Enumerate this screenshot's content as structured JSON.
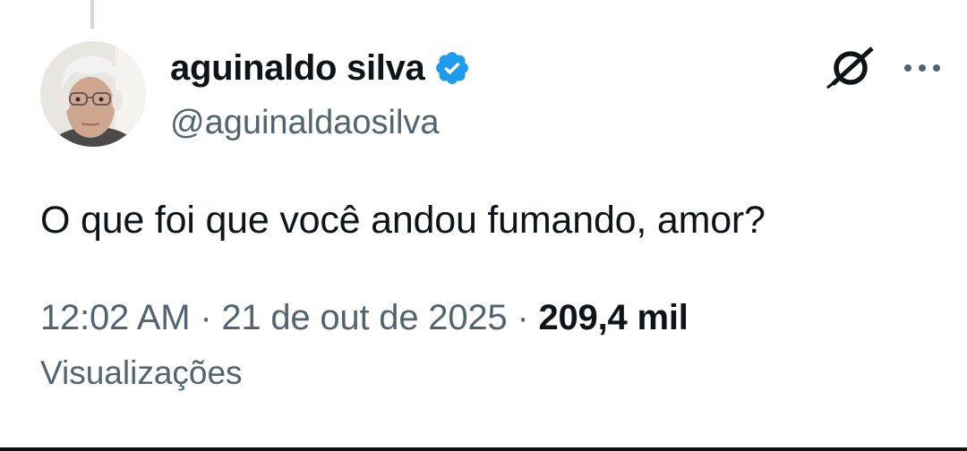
{
  "author": {
    "display_name": "aguinaldo silva",
    "handle": "@aguinaldaosilva"
  },
  "tweet": {
    "text": "O que foi que você andou fumando, amor?"
  },
  "meta": {
    "time": "12:02 AM",
    "separator": " · ",
    "date": "21 de out de 2025",
    "views_count": "209,4 mil",
    "views_label": "Visualizações"
  },
  "icons": {
    "verified": "verified-badge-icon",
    "grok": "grok-icon",
    "more": "more-options-icon"
  },
  "colors": {
    "verified": "#1d9bf0",
    "primary_text": "#0f1419",
    "secondary_text": "#536471"
  }
}
